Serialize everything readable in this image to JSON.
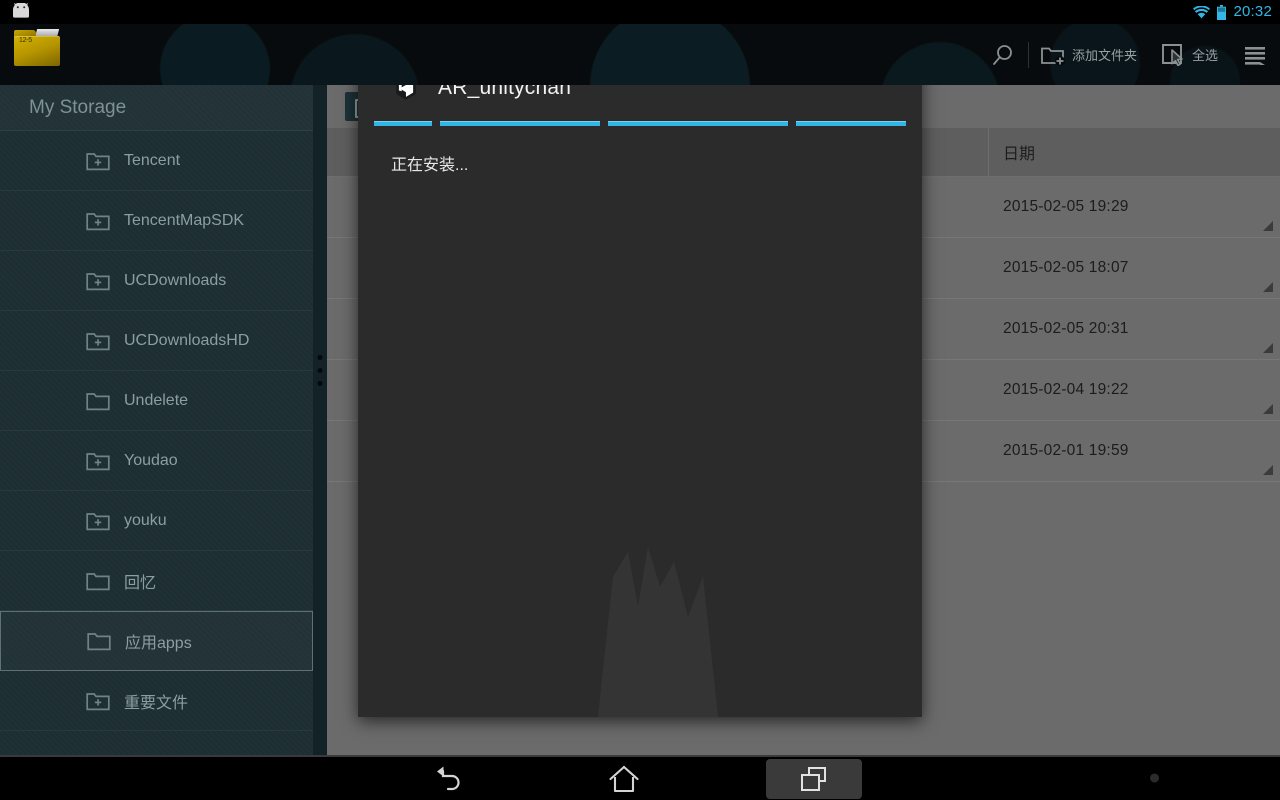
{
  "statusbar": {
    "clock": "20:32",
    "wifi_icon": "wifi-icon",
    "battery_icon": "battery-icon",
    "accent_color": "#33b5e5"
  },
  "topbar": {
    "app_icon": "folder-app-icon",
    "app_icon_text": "12-5",
    "actions": [
      {
        "id": "search",
        "icon": "search-icon",
        "label": ""
      },
      {
        "id": "add-folder",
        "icon": "add-folder-icon",
        "label": "添加文件夹"
      },
      {
        "id": "select-all",
        "icon": "select-all-icon",
        "label": "全选"
      },
      {
        "id": "menu",
        "icon": "list-menu-icon",
        "label": ""
      }
    ]
  },
  "sidebar": {
    "title": "My Storage",
    "items": [
      {
        "label": "Tencent",
        "icon": "folder-add-icon",
        "selected": false
      },
      {
        "label": "TencentMapSDK",
        "icon": "folder-add-icon",
        "selected": false
      },
      {
        "label": "UCDownloads",
        "icon": "folder-add-icon",
        "selected": false
      },
      {
        "label": "UCDownloadsHD",
        "icon": "folder-add-icon",
        "selected": false
      },
      {
        "label": "Undelete",
        "icon": "folder-icon",
        "selected": false
      },
      {
        "label": "Youdao",
        "icon": "folder-add-icon",
        "selected": false
      },
      {
        "label": "youku",
        "icon": "folder-add-icon",
        "selected": false
      },
      {
        "label": "回忆",
        "icon": "folder-icon",
        "selected": false
      },
      {
        "label": "应用apps",
        "icon": "folder-icon",
        "selected": true
      },
      {
        "label": "重要文件",
        "icon": "folder-add-icon",
        "selected": false
      }
    ]
  },
  "filelist": {
    "columns": [
      "",
      "日期"
    ],
    "rows": [
      {
        "date": "2015-02-05 19:29"
      },
      {
        "date": "2015-02-05 18:07"
      },
      {
        "date": "2015-02-05 20:31"
      },
      {
        "date": "2015-02-04 19:22"
      },
      {
        "date": "2015-02-01 19:59"
      }
    ]
  },
  "dialog": {
    "icon": "unity-logo-icon",
    "title": "AR_unitychan",
    "message": "正在安装...",
    "progress_color": "#33b5e5",
    "progress_segments": 4,
    "indeterminate": true
  },
  "navbar": {
    "buttons": [
      {
        "id": "back",
        "icon": "back-arrow-icon",
        "active": false
      },
      {
        "id": "home",
        "icon": "home-icon",
        "active": false
      },
      {
        "id": "recents",
        "icon": "recents-icon",
        "active": true
      }
    ],
    "indicator": "status-dot"
  }
}
